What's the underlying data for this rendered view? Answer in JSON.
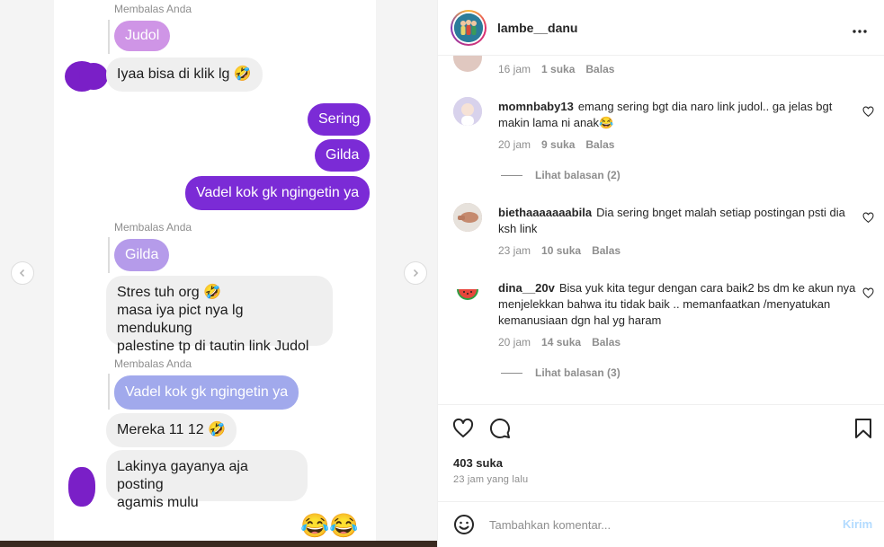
{
  "chat": {
    "top_label": "Membalas Anda",
    "msg_judol": "Judol",
    "msg_iyaa": "Iyaa bisa di klik lg 🤣",
    "msg_sering": "Sering",
    "msg_gilda": "Gilda",
    "msg_vadel": "Vadel kok gk ngingetin ya",
    "reply_label_1": "Membalas Anda",
    "msg_gilda_quote": "Gilda",
    "msg_stres_1": "Stres tuh org 🤣",
    "msg_stres_2": "masa iya pict nya lg mendukung",
    "msg_stres_3": "palestine tp di tautin link Judol",
    "reply_label_2": "Membalas Anda",
    "msg_vadel_quote": "Vadel kok gk ngingetin ya",
    "msg_mereka": "Mereka 11 12 🤣",
    "msg_lakinya_1": "Lakinya gayanya aja posting",
    "msg_lakinya_2": "agamis mulu",
    "emojis": "😂😂"
  },
  "post": {
    "username": "lambe__danu",
    "more_icon": "more-horizontal-icon"
  },
  "comments": {
    "first_meta": {
      "time": "16 jam",
      "likes": "1 suka",
      "reply": "Balas"
    },
    "items": [
      {
        "user": "momnbaby13",
        "text": "emang sering bgt dia naro link judol.. ga jelas bgt makin lama ni anak😂",
        "time": "20 jam",
        "likes": "9 suka",
        "reply": "Balas",
        "view_replies": "Lihat balasan (2)"
      },
      {
        "user": "biethaaaaaaabila",
        "text": "Dia sering bnget malah setiap postingan psti dia ksh link",
        "time": "23 jam",
        "likes": "10 suka",
        "reply": "Balas"
      },
      {
        "user": "dina__20v",
        "text": "Bisa yuk kita tegur dengan cara baik2 bs dm ke akun nya menjelekkan bahwa itu tidak baik .. memanfaatkan /menyatukan kemanusiaan dgn hal yg haram",
        "time": "20 jam",
        "likes": "14 suka",
        "reply": "Balas",
        "view_replies": "Lihat balasan (3)"
      }
    ]
  },
  "actions": {
    "likes": "403 suka",
    "time_ago": "23 jam yang lalu",
    "comment_placeholder": "Tambahkan komentar...",
    "post_label": "Kirim"
  },
  "colors": {
    "instagram_blue_disabled": "#b3dbff",
    "chat_purple": "#7b2bd6"
  }
}
